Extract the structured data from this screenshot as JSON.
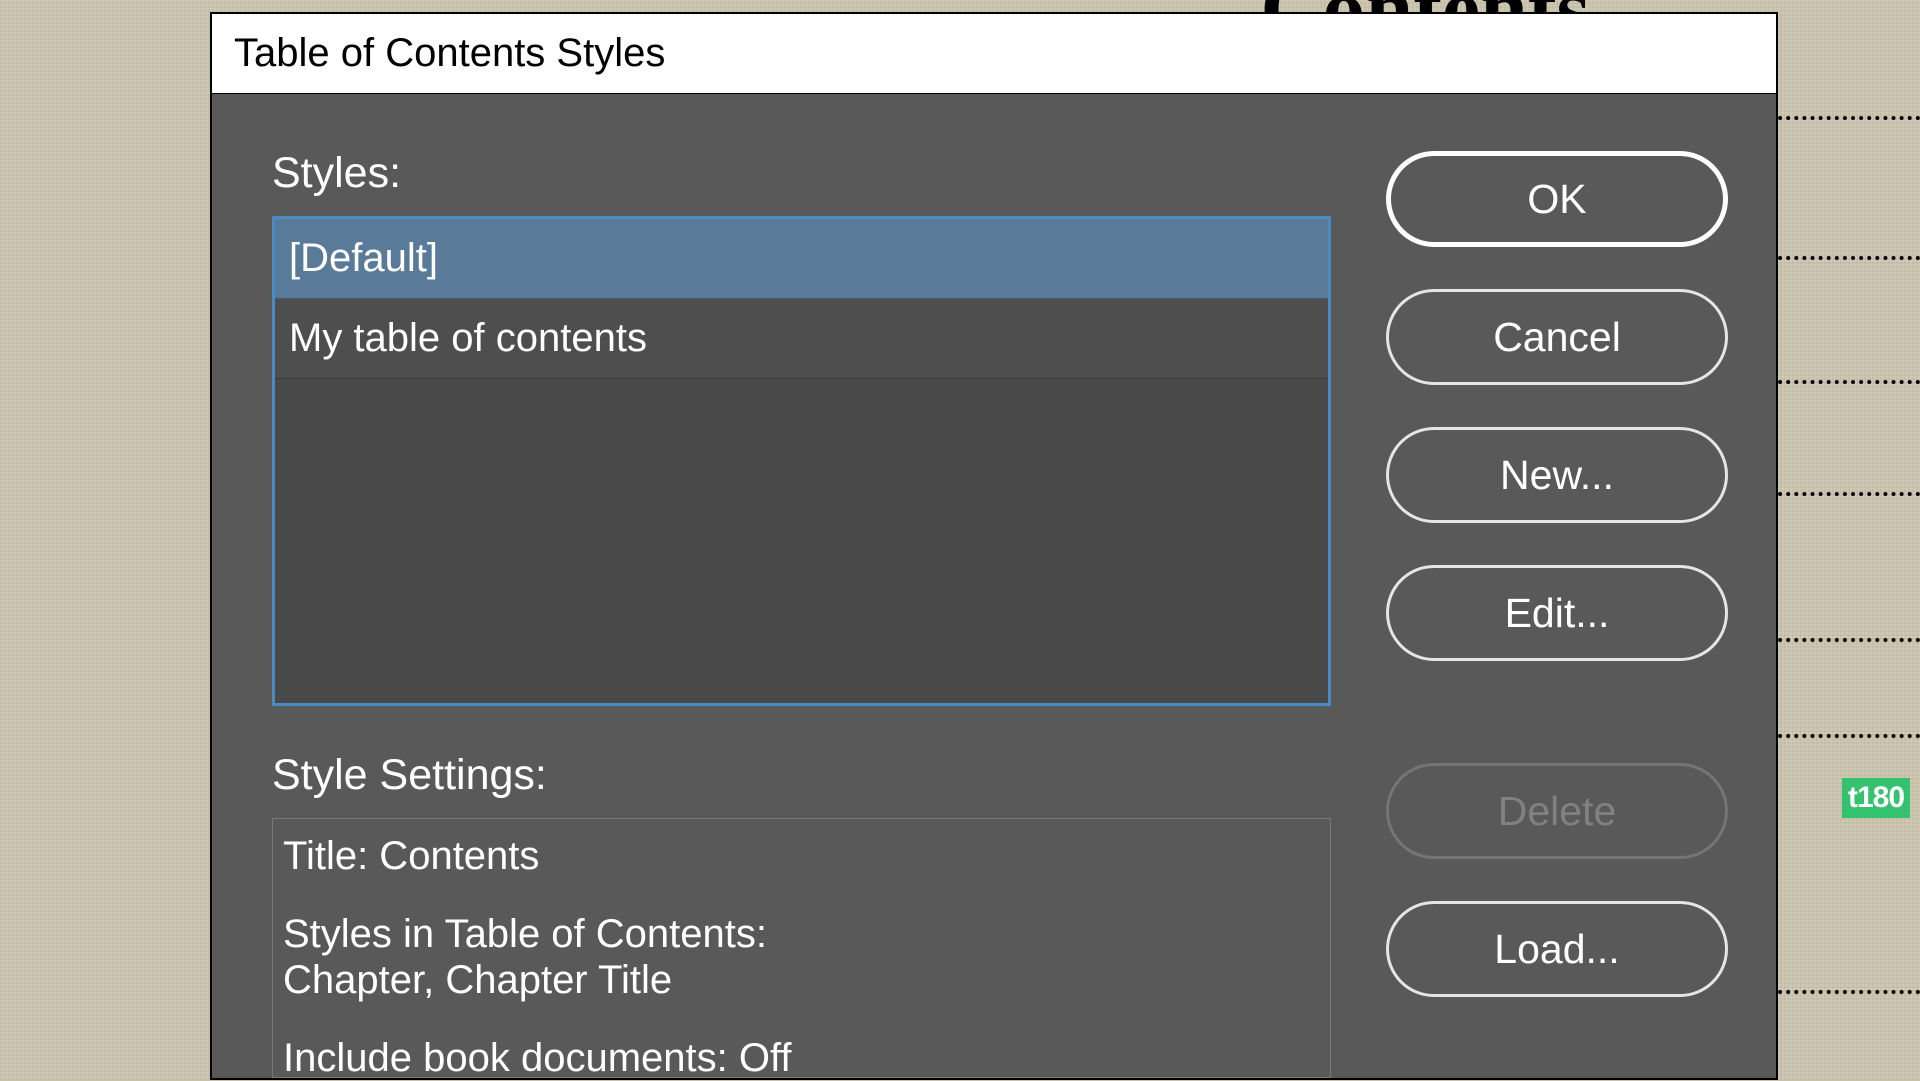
{
  "background": {
    "contents_word": "Contents"
  },
  "dialog": {
    "title": "Table of Contents Styles",
    "styles_label": "Styles:",
    "styles_list": [
      {
        "label": "[Default]",
        "selected": true
      },
      {
        "label": "My table of contents",
        "selected": false
      }
    ],
    "settings_label": "Style Settings:",
    "settings": {
      "title_line": "Title: Contents",
      "styles_in_toc_label": "Styles in Table of Contents:",
      "styles_in_toc_value": "Chapter, Chapter Title",
      "include_book_docs": "Include book documents: Off"
    },
    "buttons": {
      "ok": "OK",
      "cancel": "Cancel",
      "new": "New...",
      "edit": "Edit...",
      "delete": "Delete",
      "load": "Load..."
    }
  },
  "watermark": "t180"
}
